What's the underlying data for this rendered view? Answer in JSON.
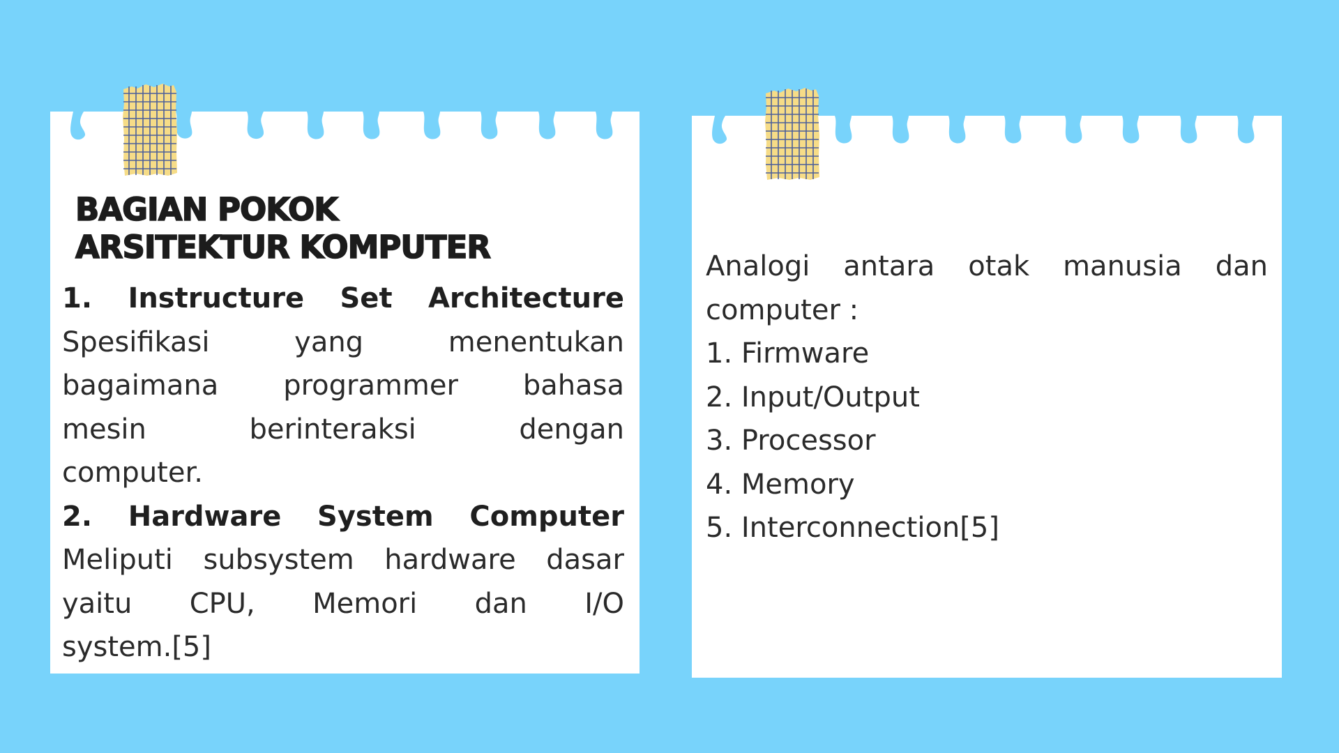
{
  "left_card": {
    "title_lines": [
      "BAGIAN POKOK",
      "ARSITEKTUR KOMPUTER"
    ],
    "item1_heading": [
      "1.",
      "Instructure",
      "Set",
      "Architecture"
    ],
    "item1_desc": [
      [
        "Spesifikasi",
        "yang",
        "menentukan"
      ],
      [
        "bagaimana",
        "programmer",
        "bahasa"
      ],
      [
        "mesin",
        "berinteraksi",
        "dengan"
      ],
      [
        "computer."
      ]
    ],
    "item2_heading": [
      "2.",
      "Hardware",
      "System",
      "Computer"
    ],
    "item2_desc": [
      [
        "Meliputi",
        "subsystem",
        "hardware",
        "dasar"
      ],
      [
        "yaitu",
        "CPU,",
        "Memori",
        "dan",
        "I/O"
      ],
      [
        "system.[5]"
      ]
    ]
  },
  "right_card": {
    "intro_line1": [
      "Analogi",
      "antara",
      "otak",
      "manusia",
      "dan"
    ],
    "intro_line2": "computer :",
    "list": [
      "1. Firmware",
      "2. Input/Output",
      "3. Processor",
      "4. Memory",
      "5. Interconnection[5]"
    ]
  },
  "colors": {
    "background": "#78d3fb",
    "card": "#ffffff",
    "tape_fill": "#f6dc87",
    "tape_grid": "#4b5f9c",
    "text": "#2a2a2a"
  },
  "icons": [
    "torn-edge-decoration",
    "grid-tape-decoration"
  ]
}
